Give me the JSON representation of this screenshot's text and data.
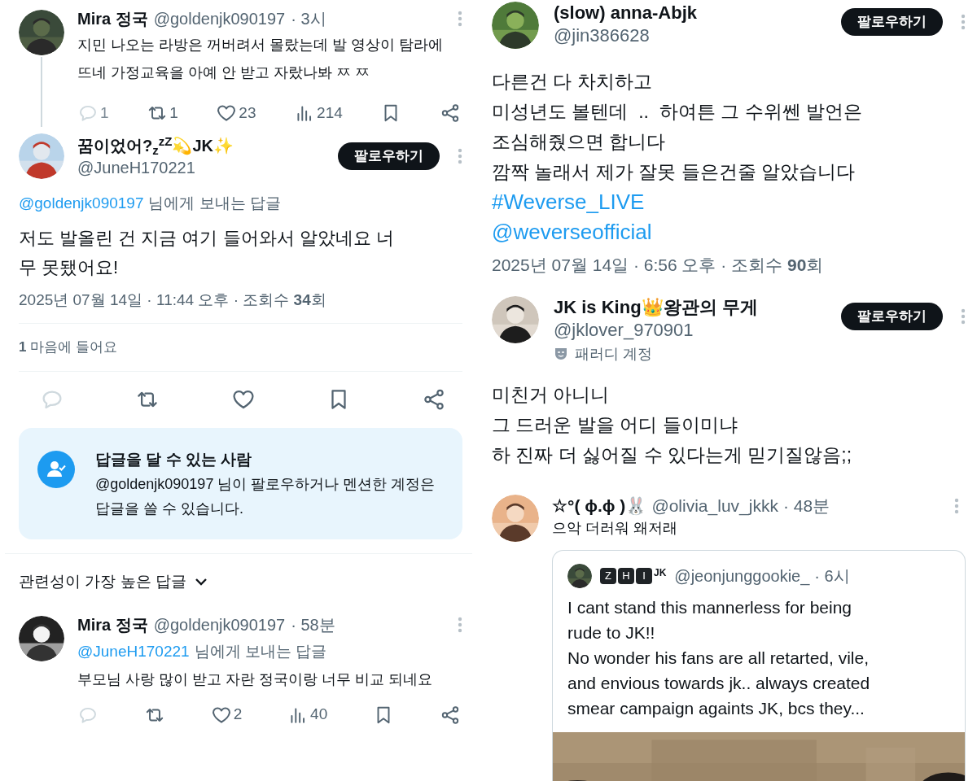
{
  "left_panel": {
    "thread_tweet": {
      "name": "Mira 정국",
      "handle": "@goldenjk090197",
      "time": "· 3시",
      "text": "지민 나오는 라방은 꺼버려서 몰랐는데 발 영상이 탐라에 뜨네 가정교육을 아예 안 받고 자랐나봐 ㅉ ㅉ",
      "actions": [
        {
          "kind": "reply",
          "count": "1"
        },
        {
          "kind": "retweet",
          "count": "1"
        },
        {
          "kind": "like",
          "count": "23"
        },
        {
          "kind": "views",
          "count": "214"
        },
        {
          "kind": "bookmark"
        },
        {
          "kind": "share"
        }
      ]
    },
    "focused_tweet": {
      "name": "꿈이었어?$_{z}$$^{zZ}$💫JK✨",
      "handle": "@JuneH170221",
      "follow_button": "팔로우하기",
      "reply_to": {
        "mention": "@goldenjk090197",
        "suffix": "님에게 보내는 답글"
      },
      "text": "저도 발올린 건 지금 여기 들어와서 알았네요 너무 못됐어요!",
      "timestamp": "2025년 07월 14일 · 11:44 오후 · 조회수 **34**회",
      "likes_summary": "**1** 마음에 들어요",
      "actions": [
        {
          "kind": "reply"
        },
        {
          "kind": "retweet"
        },
        {
          "kind": "like"
        },
        {
          "kind": "bookmark"
        },
        {
          "kind": "share"
        }
      ]
    },
    "reply_restriction": {
      "title": "답글을 달 수 있는 사람",
      "text": "@goldenjk090197 님이 팔로우하거나 멘션한 계정은 답글을 쓸 수 있습니다."
    },
    "sort_menu": {
      "label": "관련성이 가장 높은 답글"
    },
    "replies": [
      {
        "name": "Mira 정국",
        "handle": "@goldenjk090197",
        "time": "· 58분",
        "reply_to": {
          "mention": "@JuneH170221",
          "suffix": "님에게 보내는 답글"
        },
        "text": "부모님 사랑 많이 받고 자란 정국이랑 너무 비교 되네요",
        "actions": [
          {
            "kind": "reply"
          },
          {
            "kind": "retweet"
          },
          {
            "kind": "like",
            "count": "2"
          },
          {
            "kind": "views",
            "count": "40"
          },
          {
            "kind": "bookmark"
          },
          {
            "kind": "share"
          }
        ]
      }
    ]
  },
  "right_panel": {
    "tweets": [
      {
        "name": "(slow) anna-Abjk",
        "handle": "@jin386628",
        "follow_button": "팔로우하기",
        "lines": [
          "다른건 다 차치하고",
          "미성년도 볼텐데  ..  하여튼 그 수위쎈 발언은",
          "조심해줬으면 합니다",
          "깜짝 놀래서 제가 잘못 들은건줄 알았습니다"
        ],
        "links": [
          "#Weverse_LIVE",
          "@weverseofficial"
        ],
        "timestamp": "2025년 07월 14일 · 6:56 오후 · 조회수 **90**회"
      },
      {
        "name": "JK is King👑왕관의 무게",
        "handle": "@jklover_970901",
        "follow_button": "팔로우하기",
        "parody_label": "패러디 계정",
        "lines": [
          "미친거 아니니",
          "그 드러운 발을 어디 들이미냐",
          "하 진짜 더 싫어질 수 있다는게 믿기질않음;;"
        ]
      }
    ],
    "reply": {
      "name": "☆°( ɸ.ɸ )🐰",
      "handle": "@olivia_luv_jkkk",
      "time": "· 48분",
      "text": "으악 더러워 왜저래",
      "quote": {
        "name_letters": [
          "Z",
          "H",
          "I"
        ],
        "name_suffix": "JK",
        "handle": "@jeonjunggookie_",
        "time": "· 6시",
        "text": "I cant stand this mannerless for being\nrude to JK!!\nNo wonder his fans are all retarted, vile,\nand envious towards jk.. always created\nsmear campaign againts JK, bcs they..."
      }
    }
  }
}
